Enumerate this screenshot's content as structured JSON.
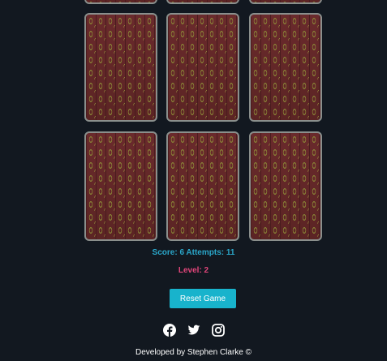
{
  "board": {
    "rows": [
      {
        "cards": [
          {
            "state": "face-down"
          },
          {
            "state": "face-down"
          },
          {
            "state": "face-down"
          }
        ]
      },
      {
        "cards": [
          {
            "state": "face-down"
          },
          {
            "state": "face-down"
          },
          {
            "state": "face-down"
          }
        ]
      },
      {
        "cards": [
          {
            "state": "face-down"
          },
          {
            "state": "face-down"
          },
          {
            "state": "face-down"
          }
        ]
      }
    ]
  },
  "stats": {
    "score_line": "Score: 6 Attempts: 11",
    "level_line": "Level: 2"
  },
  "controls": {
    "reset_label": "Reset Game"
  },
  "social": {
    "links": [
      {
        "icon": "facebook-icon"
      },
      {
        "icon": "twitter-icon"
      },
      {
        "icon": "instagram-icon"
      }
    ]
  },
  "footer": {
    "credit": "Developed by Stephen Clarke ©"
  },
  "colors": {
    "background": "#121820",
    "score": "#2aa6c9",
    "level": "#e0457a",
    "button": "#18b3cc",
    "card_back": "#5b2424"
  }
}
